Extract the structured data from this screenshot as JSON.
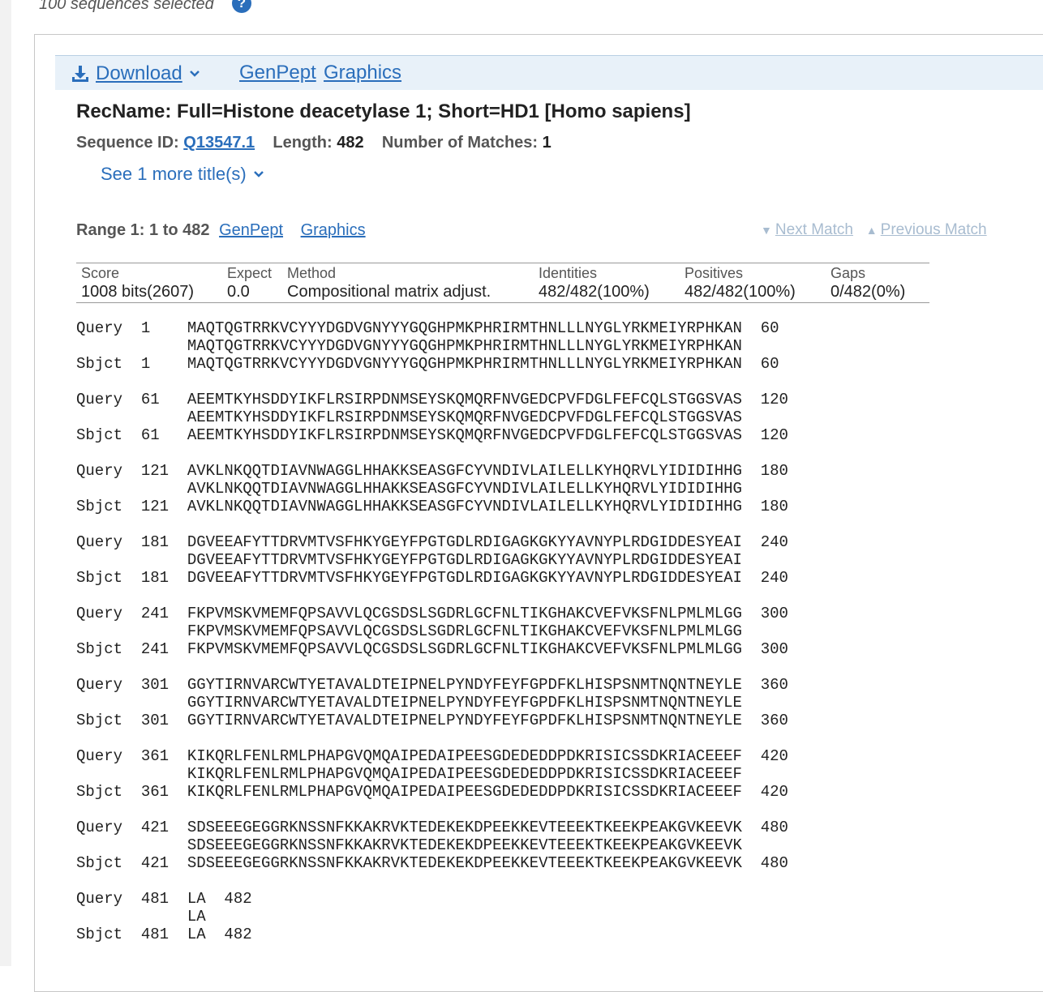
{
  "status": {
    "selected_text": "100 sequences selected",
    "help": "?"
  },
  "toolbar": {
    "download_label": "Download",
    "genpept_label": "GenPept",
    "graphics_label": "Graphics"
  },
  "record": {
    "title": "RecName: Full=Histone deacetylase 1; Short=HD1 [Homo sapiens]",
    "seq_id_label": "Sequence ID:",
    "seq_id": "Q13547.1",
    "length_label": "Length:",
    "length": "482",
    "matches_label": "Number of Matches:",
    "matches": "1",
    "see_more": "See 1 more title(s)"
  },
  "range": {
    "label": "Range 1: 1 to 482",
    "genpept_label": "GenPept",
    "graphics_label": "Graphics",
    "next_match": "Next Match",
    "prev_match": "Previous Match"
  },
  "stats": {
    "headers": [
      "Score",
      "Expect",
      "Method",
      "Identities",
      "Positives",
      "Gaps"
    ],
    "values": [
      "1008 bits(2607)",
      "0.0",
      "Compositional matrix adjust.",
      "482/482(100%)",
      "482/482(100%)",
      "0/482(0%)"
    ]
  },
  "alignment": [
    [
      "Query  1    MAQTQGTRRKVCYYYDGDVGNYYYGQGHPMKPHRIRMTHNLLLNYGLYRKMEIYRPHKAN  60",
      "            MAQTQGTRRKVCYYYDGDVGNYYYGQGHPMKPHRIRMTHNLLLNYGLYRKMEIYRPHKAN",
      "Sbjct  1    MAQTQGTRRKVCYYYDGDVGNYYYGQGHPMKPHRIRMTHNLLLNYGLYRKMEIYRPHKAN  60"
    ],
    [
      "Query  61   AEEMTKYHSDDYIKFLRSIRPDNMSEYSKQMQRFNVGEDCPVFDGLFEFCQLSTGGSVAS  120",
      "            AEEMTKYHSDDYIKFLRSIRPDNMSEYSKQMQRFNVGEDCPVFDGLFEFCQLSTGGSVAS",
      "Sbjct  61   AEEMTKYHSDDYIKFLRSIRPDNMSEYSKQMQRFNVGEDCPVFDGLFEFCQLSTGGSVAS  120"
    ],
    [
      "Query  121  AVKLNKQQTDIAVNWAGGLHHAKKSEASGFCYVNDIVLAILELLKYHQRVLYIDIDIHHG  180",
      "            AVKLNKQQTDIAVNWAGGLHHAKKSEASGFCYVNDIVLAILELLKYHQRVLYIDIDIHHG",
      "Sbjct  121  AVKLNKQQTDIAVNWAGGLHHAKKSEASGFCYVNDIVLAILELLKYHQRVLYIDIDIHHG  180"
    ],
    [
      "Query  181  DGVEEAFYTTDRVMTVSFHKYGEYFPGTGDLRDIGAGKGKYYAVNYPLRDGIDDESYEAI  240",
      "            DGVEEAFYTTDRVMTVSFHKYGEYFPGTGDLRDIGAGKGKYYAVNYPLRDGIDDESYEAI",
      "Sbjct  181  DGVEEAFYTTDRVMTVSFHKYGEYFPGTGDLRDIGAGKGKYYAVNYPLRDGIDDESYEAI  240"
    ],
    [
      "Query  241  FKPVMSKVMEMFQPSAVVLQCGSDSLSGDRLGCFNLTIKGHAKCVEFVKSFNLPMLMLGG  300",
      "            FKPVMSKVMEMFQPSAVVLQCGSDSLSGDRLGCFNLTIKGHAKCVEFVKSFNLPMLMLGG",
      "Sbjct  241  FKPVMSKVMEMFQPSAVVLQCGSDSLSGDRLGCFNLTIKGHAKCVEFVKSFNLPMLMLGG  300"
    ],
    [
      "Query  301  GGYTIRNVARCWTYETAVALDTEIPNELPYNDYFEYFGPDFKLHISPSNMTNQNTNEYLE  360",
      "            GGYTIRNVARCWTYETAVALDTEIPNELPYNDYFEYFGPDFKLHISPSNMTNQNTNEYLE",
      "Sbjct  301  GGYTIRNVARCWTYETAVALDTEIPNELPYNDYFEYFGPDFKLHISPSNMTNQNTNEYLE  360"
    ],
    [
      "Query  361  KIKQRLFENLRMLPHAPGVQMQAIPEDAIPEESGDEDEDDPDKRISICSSDKRIACEEEF  420",
      "            KIKQRLFENLRMLPHAPGVQMQAIPEDAIPEESGDEDEDDPDKRISICSSDKRIACEEEF",
      "Sbjct  361  KIKQRLFENLRMLPHAPGVQMQAIPEDAIPEESGDEDEDDPDKRISICSSDKRIACEEEF  420"
    ],
    [
      "Query  421  SDSEEEGEGGRKNSSNFKKAKRVKTEDEKEKDPEEKKEVTEEEKTKEEKPEAKGVKEEVK  480",
      "            SDSEEEGEGGRKNSSNFKKAKRVKTEDEKEKDPEEKKEVTEEEKTKEEKPEAKGVKEEVK",
      "Sbjct  421  SDSEEEGEGGRKNSSNFKKAKRVKTEDEKEKDPEEKKEVTEEEKTKEEKPEAKGVKEEVK  480"
    ],
    [
      "Query  481  LA  482",
      "            LA",
      "Sbjct  481  LA  482"
    ]
  ]
}
